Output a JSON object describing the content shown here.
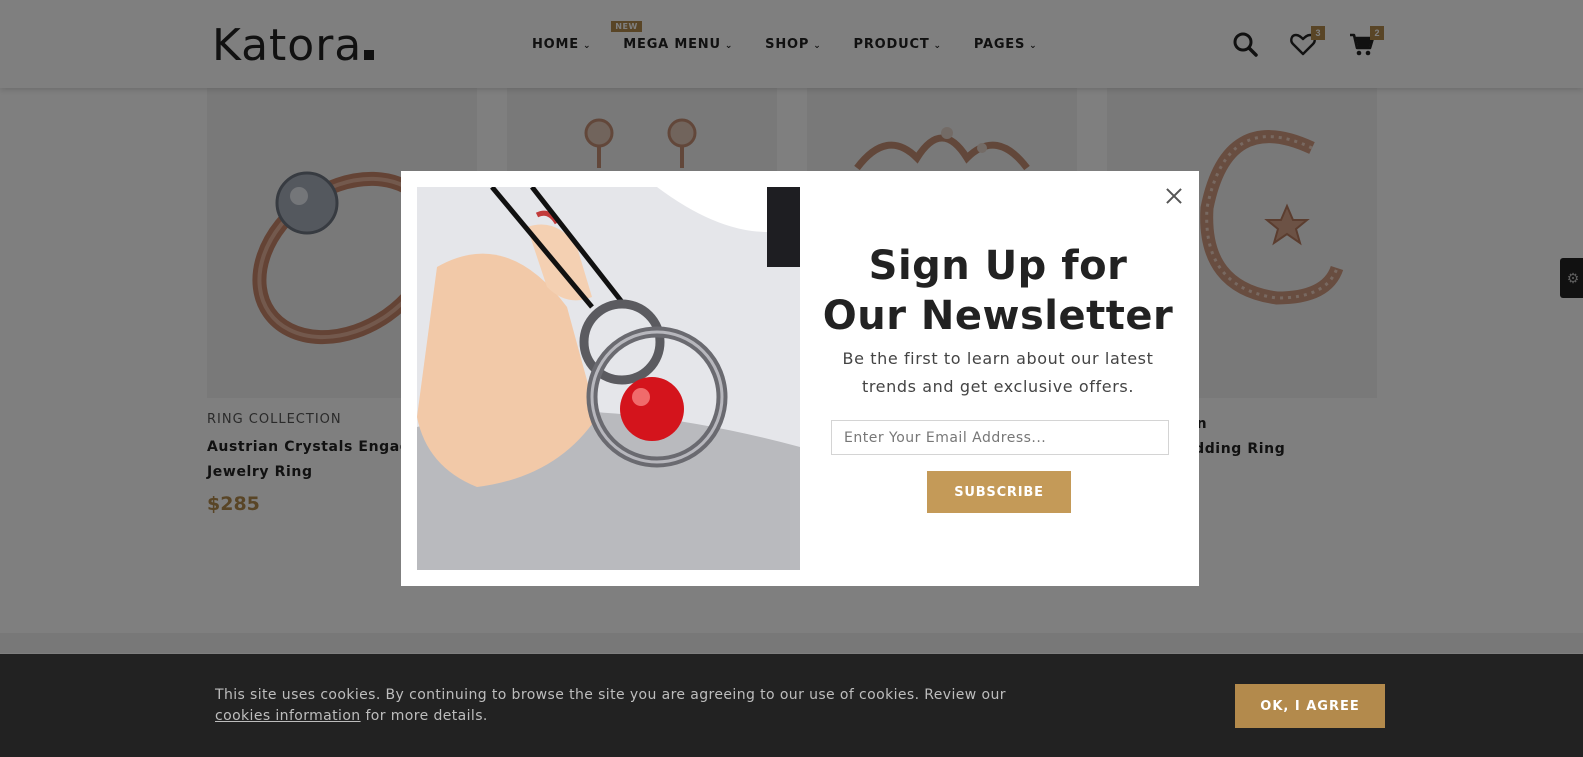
{
  "header": {
    "logo": "Katora",
    "nav": [
      {
        "label": "HOME",
        "badge": ""
      },
      {
        "label": "MEGA MENU",
        "badge": "NEW"
      },
      {
        "label": "SHOP",
        "badge": ""
      },
      {
        "label": "PRODUCT",
        "badge": ""
      },
      {
        "label": "PAGES",
        "badge": ""
      }
    ],
    "icons": [
      "search-icon",
      "heart-icon",
      "cart-icon"
    ],
    "wishlist_count": "3",
    "cart_count": "2"
  },
  "products": [
    {
      "category": "RING COLLECTION",
      "name_line1": "Austrian Crystals Engag",
      "name_line2": "Jewelry Ring",
      "price": "$285"
    },
    {
      "category": "",
      "name_line1": "",
      "name_line2": "",
      "price": ""
    },
    {
      "category": "",
      "name_line1": "",
      "name_line2": "",
      "price": ""
    },
    {
      "category": "",
      "name_line1": "ystal Zircon",
      "name_line2": "nt And Wedding Ring",
      "price": ""
    }
  ],
  "modal": {
    "title_line1": "Sign Up for",
    "title_line2": "Our Newsletter",
    "text_line1": "Be the first to learn about our latest",
    "text_line2": "trends and get exclusive offers.",
    "email_placeholder": "Enter Your Email Address...",
    "subscribe_label": "SUBSCRIBE"
  },
  "cookie": {
    "text_part1": "This site uses cookies. By continuing to browse the site you are agreeing to our use of cookies. Review our",
    "link_text": "cookies information",
    "text_part2": "for more details.",
    "button_label": "OK, I AGREE"
  },
  "colors": {
    "accent": "#b38a4c",
    "dark": "#222222",
    "overlay": "rgba(0,0,0,0.5)"
  }
}
